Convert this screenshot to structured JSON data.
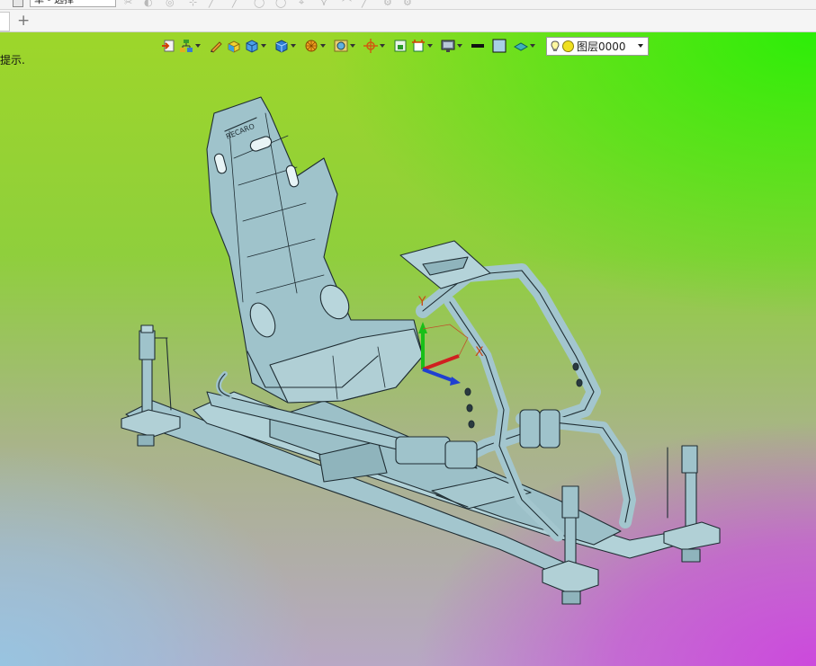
{
  "top": {
    "select_label": "单 - 选择"
  },
  "tabbar": {
    "add_tab": "+"
  },
  "viewport": {
    "hint_text": "提示."
  },
  "toolbar": {
    "layer_name": "图层0000",
    "icons": [
      "import-icon",
      "tree-icon",
      "pencil-icon",
      "box-icon",
      "cube-icon",
      "solid-icon",
      "sphere-icon",
      "render-icon",
      "move-icon",
      "frame-icon",
      "section-icon",
      "monitor-icon",
      "line-weight-icon",
      "color-swatch-icon",
      "surface-icon",
      "bulb-icon"
    ]
  },
  "model": {
    "seat_brand": "RECARO",
    "axis_x": "X",
    "axis_y": "Y",
    "seat_color": "#9fc3cb",
    "frame_color": "#a3c6ce",
    "outline_color": "#1f2d33"
  }
}
